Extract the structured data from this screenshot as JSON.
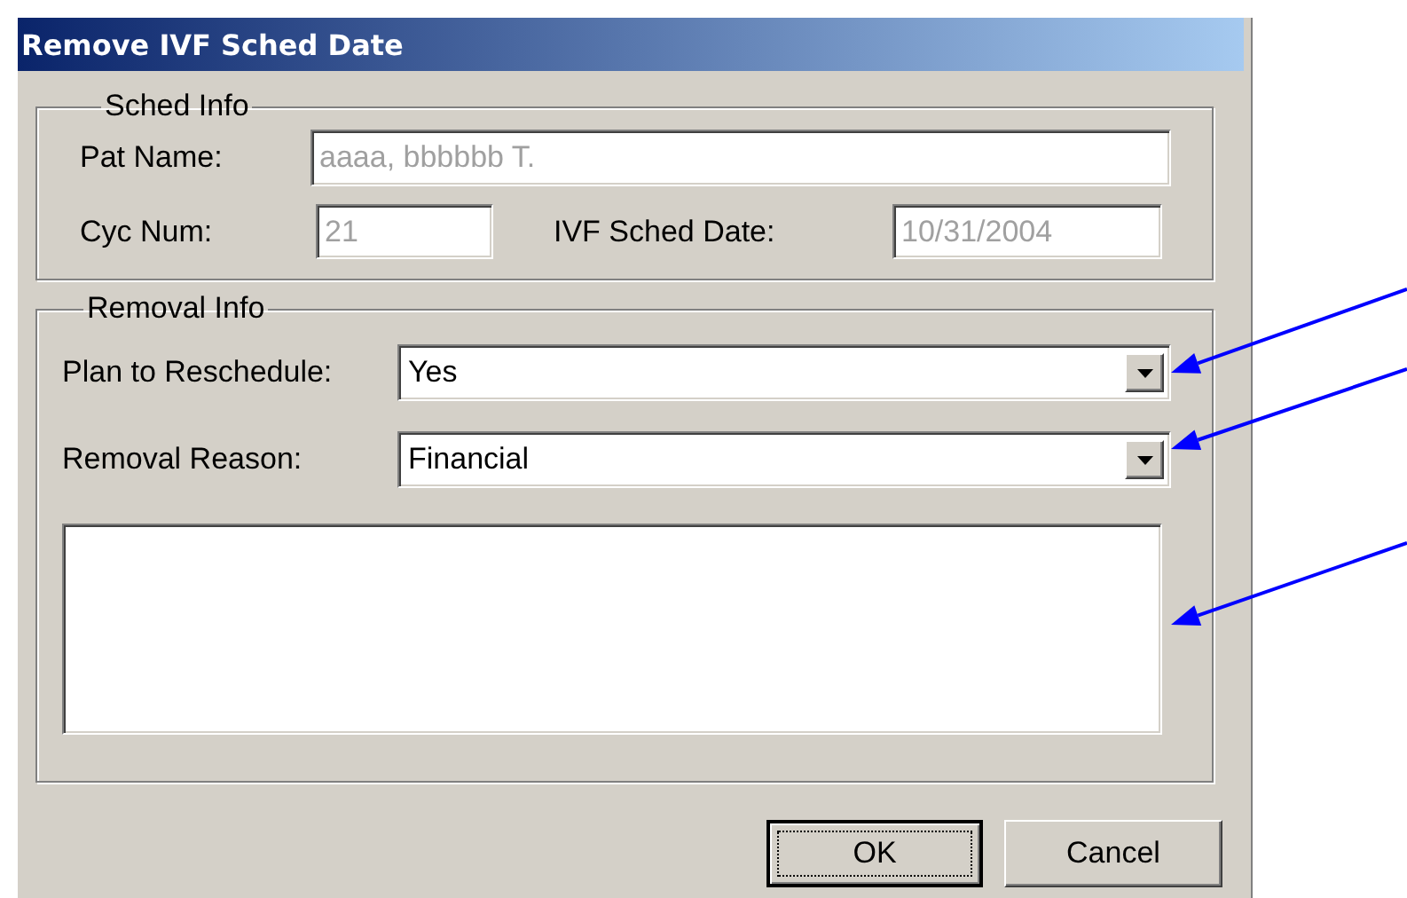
{
  "window": {
    "title": "Remove IVF Sched Date"
  },
  "sched_info": {
    "title": "Sched Info",
    "pat_name": {
      "label": "Pat Name:",
      "value": "aaaa, bbbbbb T.",
      "disabled": true
    },
    "cyc_num": {
      "label": "Cyc Num:",
      "value": "21",
      "disabled": true
    },
    "ivf_sched_date": {
      "label": "IVF Sched Date:",
      "value": "10/31/2004",
      "disabled": true
    }
  },
  "removal_info": {
    "title": "Removal Info",
    "plan_to_reschedule": {
      "label": "Plan to Reschedule:",
      "value": "Yes"
    },
    "removal_reason": {
      "label": "Removal Reason:",
      "value": "Financial"
    }
  },
  "buttons": [
    {
      "label": "OK",
      "default": true
    },
    {
      "label": "Cancel",
      "default": false
    }
  ]
}
